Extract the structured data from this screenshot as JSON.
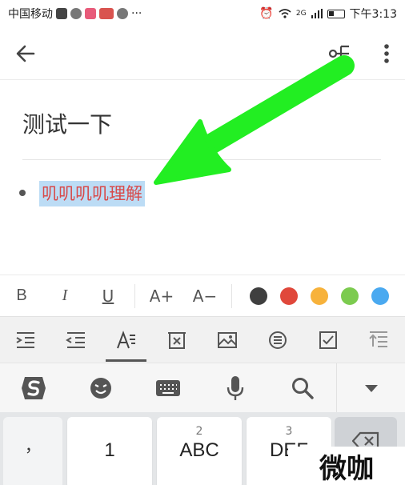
{
  "status_bar": {
    "carrier": "中国移动",
    "network_label": "2G",
    "time": "下午3:13"
  },
  "toolbar": {
    "back_icon": "arrow-left-icon",
    "mindmap_icon": "mind-map-icon",
    "more_icon": "more-vertical-icon"
  },
  "note": {
    "title": "测试一下",
    "bullet_text": "叽叽叽叽理解",
    "bullet_highlight_color": "#bcdcf5",
    "bullet_text_color": "#d84a4a"
  },
  "annotation": {
    "arrow_color": "#22ee22"
  },
  "format_bar": {
    "bold": "B",
    "italic": "I",
    "underline": "U",
    "font_increase": "A+",
    "font_decrease": "A−",
    "text_colors": [
      "#3f3f3f",
      "#e0483b",
      "#f7b23b",
      "#7ccb4f",
      "#4aa9f0"
    ]
  },
  "tools_bar": {
    "items": [
      "indent-icon",
      "outdent-icon",
      "text-format-icon",
      "delete-line-icon",
      "image-icon",
      "list-icon",
      "checkbox-icon",
      "align-top-icon"
    ],
    "active_index": 2
  },
  "ime_bar": {
    "items": [
      "sogou-logo-icon",
      "emoji-icon",
      "keyboard-icon",
      "microphone-icon",
      "search-icon",
      "collapse-icon"
    ]
  },
  "keyboard": {
    "punct_top": "，",
    "punct_bottom": "。",
    "keys": [
      {
        "number": "",
        "main": "1"
      },
      {
        "number": "2",
        "main": "ABC"
      },
      {
        "number": "3",
        "main": "DEF"
      }
    ],
    "delete_icon": "backspace-icon"
  },
  "watermark": {
    "text": "微咖"
  }
}
